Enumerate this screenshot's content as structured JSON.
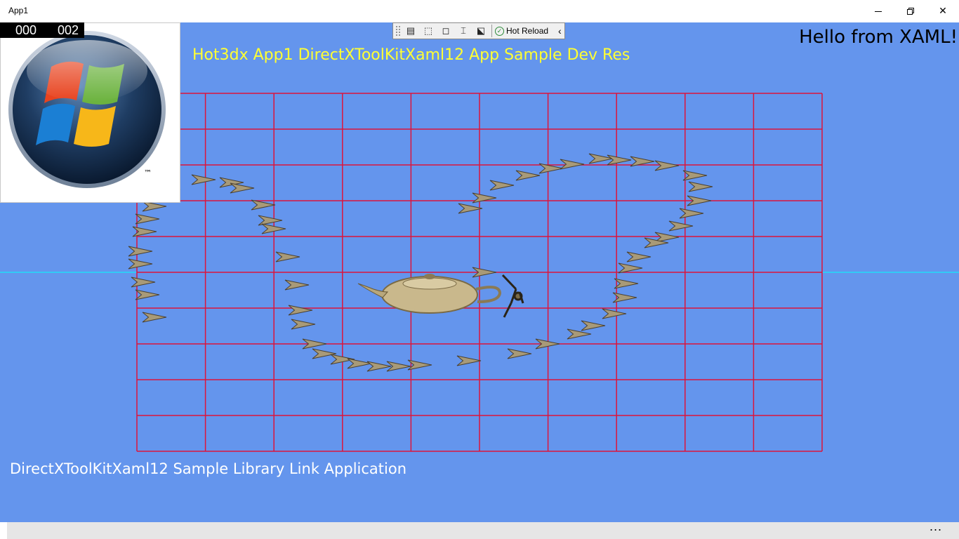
{
  "window": {
    "title": "App1",
    "minimize_icon": "minimize-icon",
    "maximize_icon": "restore-icon",
    "close_label": "✕"
  },
  "frame_counter": {
    "left": "000",
    "right": "002"
  },
  "devtools_toolbar": {
    "icons": [
      "live-visual-tree-icon",
      "select-element-icon",
      "display-layout-adorners-icon",
      "track-focus-icon",
      "show-binding-failures-icon"
    ],
    "hot_reload_label": "Hot Reload",
    "hot_reload_status": "ok",
    "collapse_label": "‹"
  },
  "texts": {
    "title": "Hot3dx App1 DirectXToolKitXaml12 App Sample Dev Res",
    "hello": "Hello from XAML!",
    "footer": "DirectXToolKitXaml12 Sample Library Link Application"
  },
  "logo": {
    "name": "windows-logo",
    "trademark": "™"
  },
  "appbar": {
    "more_label": "..."
  },
  "colors": {
    "background": "#6495ed",
    "grid": "#dc143c",
    "title_text": "#ffff33",
    "horizon_line": "#00ffff",
    "footer_text": "#ffffff"
  }
}
